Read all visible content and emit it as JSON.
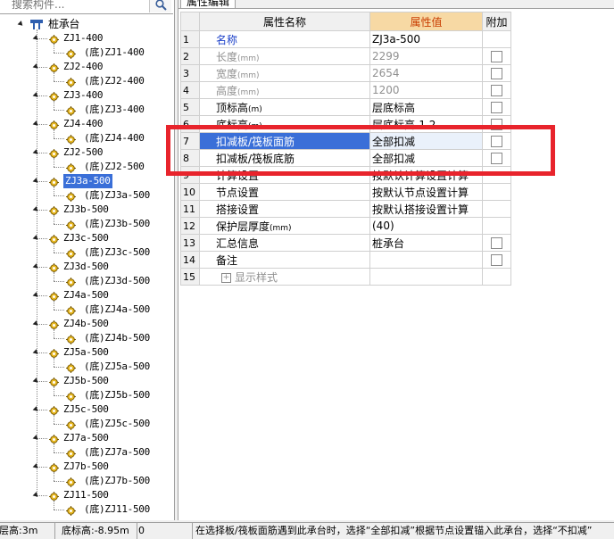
{
  "search": {
    "placeholder": "搜索构件..."
  },
  "tree": {
    "root_label": "桩承台",
    "nodes": [
      {
        "label": "ZJ1-400",
        "child": "(底)ZJ1-400"
      },
      {
        "label": "ZJ2-400",
        "child": "(底)ZJ2-400"
      },
      {
        "label": "ZJ3-400",
        "child": "(底)ZJ3-400"
      },
      {
        "label": "ZJ4-400",
        "child": "(底)ZJ4-400"
      },
      {
        "label": "ZJ2-500",
        "child": "(底)ZJ2-500"
      },
      {
        "label": "ZJ3a-500",
        "child": "(底)ZJ3a-500",
        "selected": true
      },
      {
        "label": "ZJ3b-500",
        "child": "(底)ZJ3b-500"
      },
      {
        "label": "ZJ3c-500",
        "child": "(底)ZJ3c-500"
      },
      {
        "label": "ZJ3d-500",
        "child": "(底)ZJ3d-500"
      },
      {
        "label": "ZJ4a-500",
        "child": "(底)ZJ4a-500"
      },
      {
        "label": "ZJ4b-500",
        "child": "(底)ZJ4b-500"
      },
      {
        "label": "ZJ5a-500",
        "child": "(底)ZJ5a-500"
      },
      {
        "label": "ZJ5b-500",
        "child": "(底)ZJ5b-500"
      },
      {
        "label": "ZJ5c-500",
        "child": "(底)ZJ5c-500"
      },
      {
        "label": "ZJ7a-500",
        "child": "(底)ZJ7a-500"
      },
      {
        "label": "ZJ7b-500",
        "child": "(底)ZJ7b-500"
      },
      {
        "label": "ZJ11-500",
        "child": "(底)ZJ11-500"
      }
    ]
  },
  "properties": {
    "tab_label": "属性编辑",
    "col_name": "属性名称",
    "col_value": "属性值",
    "col_extra": "附加",
    "rows": [
      {
        "num": "1",
        "name": "名称",
        "unit": "",
        "value": "ZJ3a-500",
        "style": "blue",
        "check": false
      },
      {
        "num": "2",
        "name": "长度",
        "unit": "(mm)",
        "value": "2299",
        "style": "gray",
        "check": true
      },
      {
        "num": "3",
        "name": "宽度",
        "unit": "(mm)",
        "value": "2654",
        "style": "gray",
        "check": true
      },
      {
        "num": "4",
        "name": "高度",
        "unit": "(mm)",
        "value": "1200",
        "style": "gray",
        "check": true
      },
      {
        "num": "5",
        "name": "顶标高",
        "unit": "(m)",
        "value": "层底标高",
        "style": "normal",
        "check": true
      },
      {
        "num": "6",
        "name": "底标高",
        "unit": "(m)",
        "value": "层底标高-1.2",
        "style": "normal",
        "check": true
      },
      {
        "num": "7",
        "name": "扣减板/筏板面筋",
        "unit": "",
        "value": "全部扣减",
        "style": "selected",
        "check": true
      },
      {
        "num": "8",
        "name": "扣减板/筏板底筋",
        "unit": "",
        "value": "全部扣减",
        "style": "normal",
        "check": true
      },
      {
        "num": "9",
        "name": "计算设置",
        "unit": "",
        "value": "按默认计算设置计算",
        "style": "normal",
        "check": false
      },
      {
        "num": "10",
        "name": "节点设置",
        "unit": "",
        "value": "按默认节点设置计算",
        "style": "normal",
        "check": false
      },
      {
        "num": "11",
        "name": "搭接设置",
        "unit": "",
        "value": "按默认搭接设置计算",
        "style": "normal",
        "check": false
      },
      {
        "num": "12",
        "name": "保护层厚度",
        "unit": "(mm)",
        "value": "(40)",
        "style": "normal",
        "check": false
      },
      {
        "num": "13",
        "name": "汇总信息",
        "unit": "",
        "value": "桩承台",
        "style": "normal",
        "check": true
      },
      {
        "num": "14",
        "name": "备注",
        "unit": "",
        "value": "",
        "style": "normal",
        "check": true
      },
      {
        "num": "15",
        "name": "显示样式",
        "unit": "",
        "value": "",
        "style": "group",
        "check": false
      }
    ]
  },
  "status": {
    "layer_height": "层高:3m",
    "bottom_elev": "底标高:-8.95m",
    "count": "0",
    "hint": "在选择板/筏板面筋遇到此承台时，选择“全部扣减”根据节点设置锚入此承台，选择“不扣减”"
  },
  "colors": {
    "highlight": "#e8242c",
    "selection": "#3a6fd8",
    "value_header": "#f7d9a4"
  }
}
